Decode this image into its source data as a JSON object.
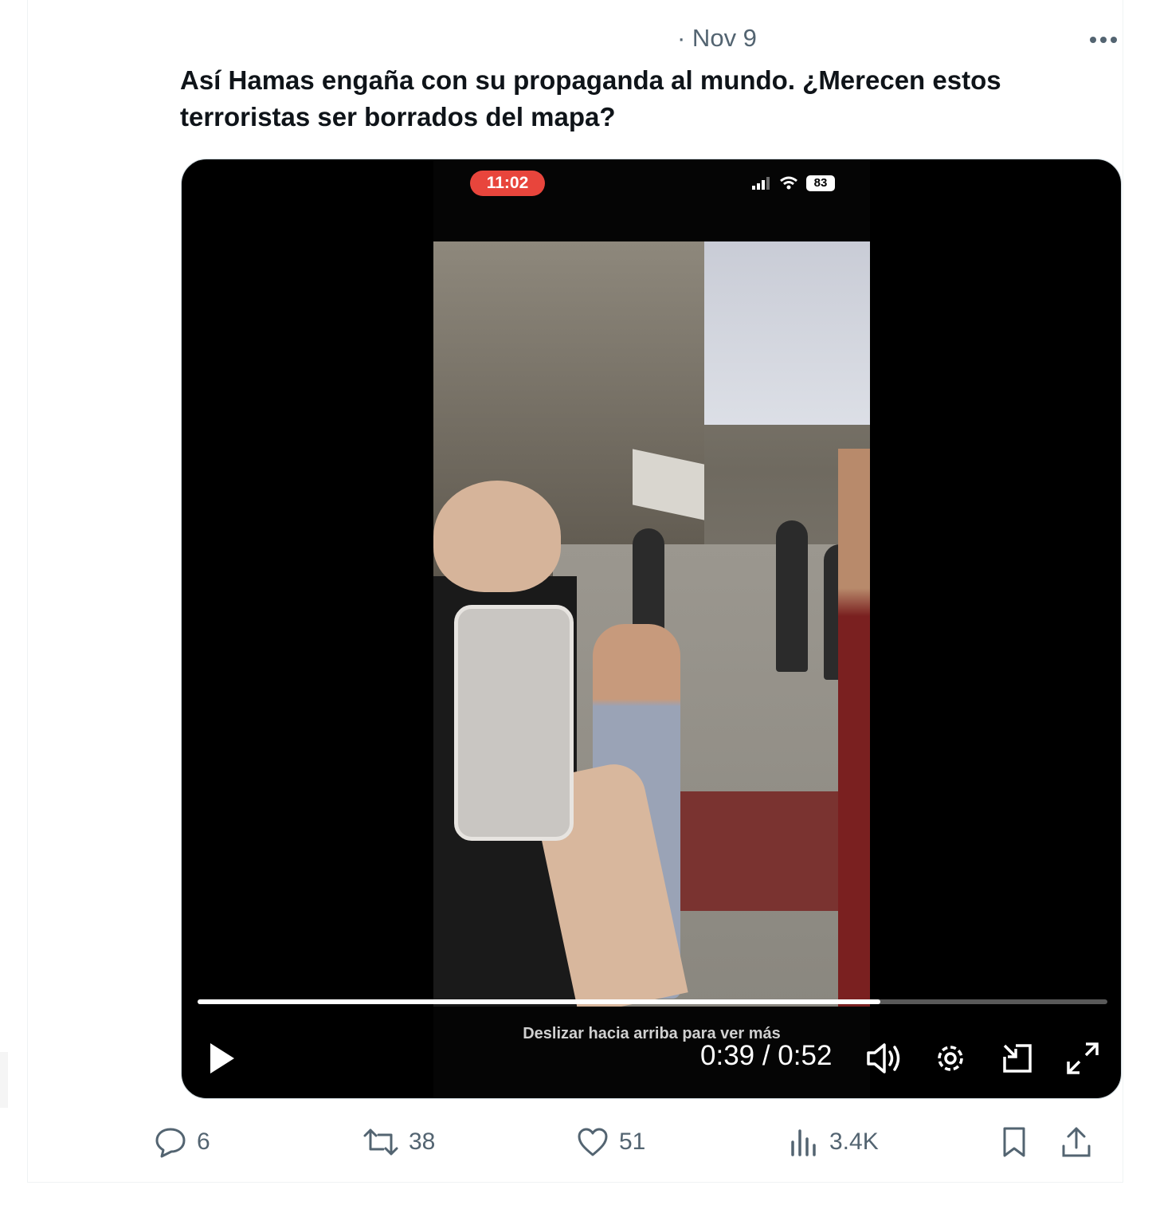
{
  "tweet": {
    "timestamp": "· Nov 9",
    "more_label": "More",
    "text": "Así Hamas engaña con su propaganda al mundo. ¿Merecen estos terroristas ser borrados del mapa?"
  },
  "video": {
    "status_time": "11:02",
    "battery": "83",
    "swipe_hint": "Deslizar hacia arriba para ver más",
    "current_time": "0:39",
    "duration": "0:52",
    "time_display": "0:39 / 0:52",
    "progress_fraction": 0.75,
    "controls": [
      "play-icon",
      "volume-icon",
      "settings-icon",
      "pop-out-icon",
      "fullscreen-icon"
    ]
  },
  "actions": {
    "replies": "6",
    "reposts": "38",
    "likes": "51",
    "views": "3.4K"
  },
  "colors": {
    "text": "#0f1419",
    "secondary": "#536471",
    "status_red": "#e8453c"
  }
}
